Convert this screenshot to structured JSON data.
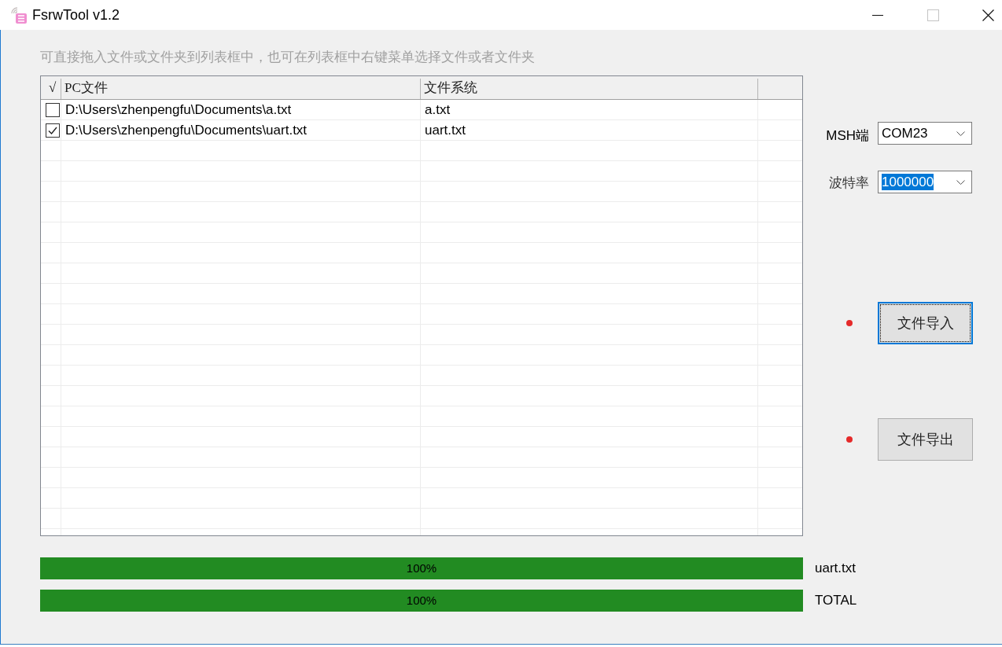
{
  "window": {
    "title": "FsrwTool v1.2",
    "controls": [
      {
        "kind": "minimize",
        "disabled": false
      },
      {
        "kind": "maximize",
        "disabled": true
      },
      {
        "kind": "close",
        "disabled": false
      }
    ]
  },
  "hint": "可直接拖入文件或文件夹到列表框中，也可在列表框中右键菜单选择文件或者文件夹",
  "file_table": {
    "columns": [
      "√",
      "PC文件",
      "文件系统"
    ],
    "rows": [
      {
        "checked": false,
        "pc_file": "D:\\Users\\zhenpengfu\\Documents\\a.txt",
        "fs_file": "a.txt"
      },
      {
        "checked": true,
        "pc_file": "D:\\Users\\zhenpengfu\\Documents\\uart.txt",
        "fs_file": "uart.txt"
      }
    ]
  },
  "settings": [
    {
      "label": "MSH端",
      "value": "COM23",
      "text_selected": false
    },
    {
      "label": "波特率",
      "value": "1000000",
      "text_selected": true
    }
  ],
  "actions": [
    {
      "label": "文件导入",
      "focused": true,
      "color": "#e52a2a"
    },
    {
      "label": "文件导出",
      "focused": false,
      "color": "#e52a2a"
    }
  ],
  "progress": [
    {
      "level": 1,
      "text": "100%",
      "label": "uart.txt"
    },
    {
      "level": 1,
      "text": "100%",
      "label": "TOTAL"
    }
  ]
}
